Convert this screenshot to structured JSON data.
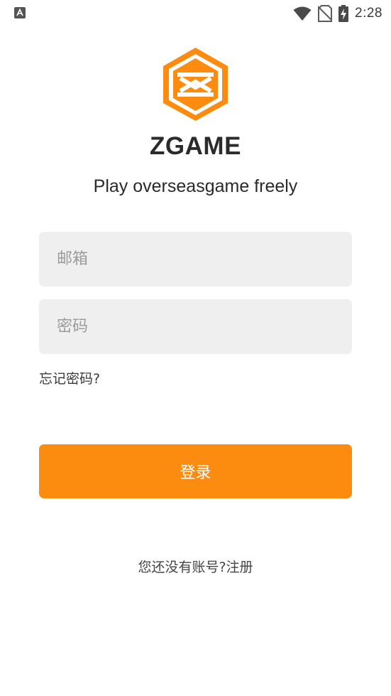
{
  "status_bar": {
    "time": "2:28",
    "icons": [
      "notification-a-icon",
      "wifi-icon",
      "no-sim-icon",
      "battery-charging-icon"
    ]
  },
  "app": {
    "name": "ZGAME",
    "tagline": "Play overseasgame freely",
    "logo_icon": "hexagon-logo-icon",
    "accent_color": "#fb8c0f"
  },
  "form": {
    "email_placeholder": "邮箱",
    "email_value": "",
    "password_placeholder": "密码",
    "password_value": "",
    "forgot_label": "忘记密码?",
    "login_label": "登录"
  },
  "register": {
    "prompt": "您还没有账号?",
    "link_label": "注册"
  }
}
